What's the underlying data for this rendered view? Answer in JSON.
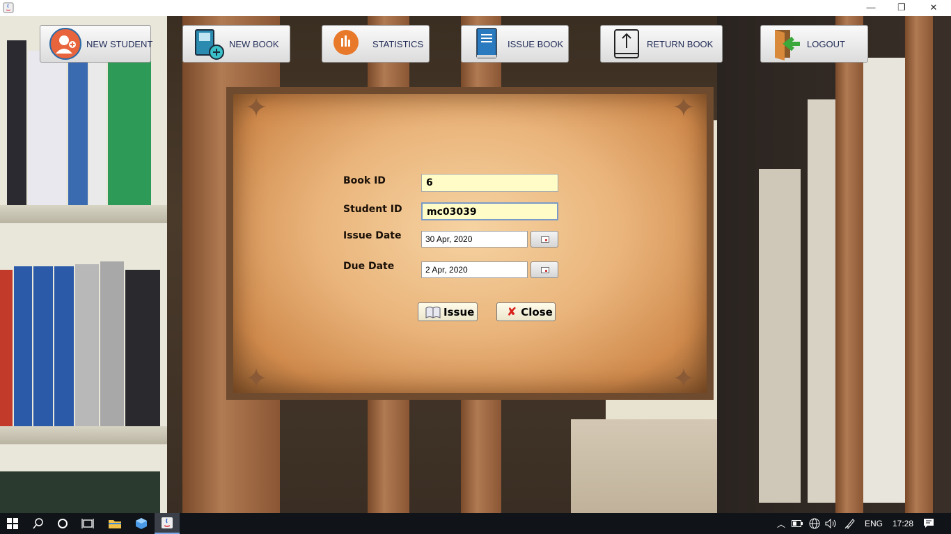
{
  "window": {
    "minimize_glyph": "—",
    "restore_glyph": "❐",
    "close_glyph": "✕"
  },
  "toolbar": [
    {
      "label": "NEW STUDENT",
      "icon": "student-avatar-icon"
    },
    {
      "label": "NEW BOOK",
      "icon": "add-book-icon"
    },
    {
      "label": "STATISTICS",
      "icon": "statistics-chart-icon"
    },
    {
      "label": "ISSUE BOOK",
      "icon": "issue-book-icon"
    },
    {
      "label": "RETURN BOOK",
      "icon": "return-book-icon"
    },
    {
      "label": "LOGOUT",
      "icon": "logout-door-icon"
    }
  ],
  "form": {
    "book_id_label": "Book ID",
    "book_id_value": "6",
    "student_id_label": "Student ID",
    "student_id_value": "mc03039",
    "issue_date_label": "Issue Date",
    "issue_date_value": "30 Apr, 2020",
    "due_date_label": "Due Date",
    "due_date_value": "2 Apr, 2020",
    "issue_button": "Issue",
    "close_button": "Close"
  },
  "taskbar": {
    "language": "ENG",
    "time": "17:28"
  },
  "colors": {
    "toolbar_text": "#1f2a55",
    "input_bg": "#fffcc8",
    "parchment": "#eab57c",
    "taskbar": "#101318"
  }
}
